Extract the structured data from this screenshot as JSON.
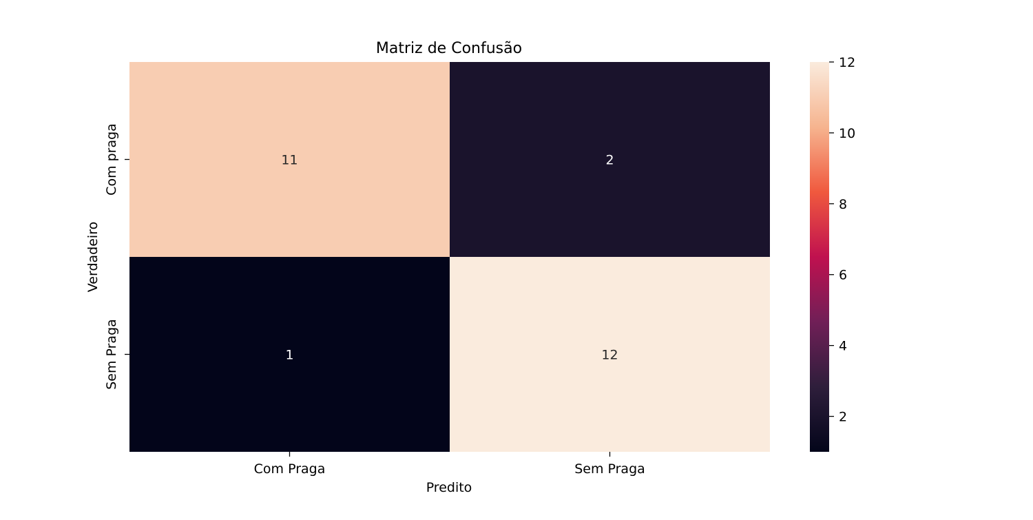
{
  "chart_data": {
    "type": "heatmap",
    "title": "Matriz de Confusão",
    "xlabel": "Predito",
    "ylabel": "Verdadeiro",
    "x_categories": [
      "Com Praga",
      "Sem Praga"
    ],
    "y_categories": [
      "Com praga",
      "Sem Praga"
    ],
    "values": [
      [
        11,
        2
      ],
      [
        1,
        12
      ]
    ],
    "colorbar": {
      "min": 1,
      "max": 12,
      "ticks": [
        2,
        4,
        6,
        8,
        10,
        12
      ],
      "colormap": "rocket",
      "colors": [
        "#03051A",
        "#2E1E3B",
        "#701F57",
        "#C0114F",
        "#F0593E",
        "#F6B48F",
        "#FAEBDD"
      ]
    },
    "legend": "right",
    "grid": false
  }
}
